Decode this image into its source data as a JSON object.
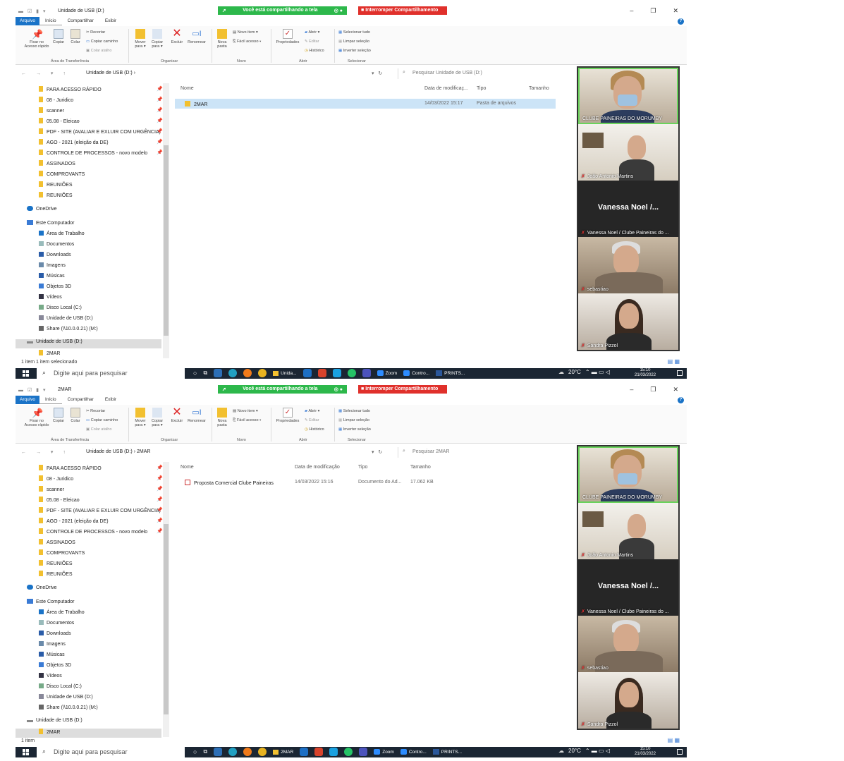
{
  "common": {
    "share_banner": "Você está compartilhando a tela",
    "stop_share": "Interromper Compartilhamento",
    "tabs": [
      "Arquivo",
      "Início",
      "Compartilhar",
      "Exibir"
    ],
    "ribbon": {
      "pin": "Fixar no\nAcesso rápido",
      "copy": "Copiar",
      "paste": "Colar",
      "cut": "Recortar",
      "copy_path": "Copiar caminho",
      "paste_shortcut": "Colar atalho",
      "move_to": "Mover\npara ▾",
      "copy_to": "Copiar\npara ▾",
      "delete": "Excluir",
      "rename": "Renomear",
      "new_folder": "Nova\npasta",
      "new_item": "Novo item ▾",
      "easy_access": "Fácil acesso ▾",
      "properties": "Propriedades",
      "open": "Abrir ▾",
      "edit": "Editar",
      "history": "Histórico",
      "select_all": "Selecionar tudo",
      "select_none": "Limpar seleção",
      "invert": "Inverter seleção",
      "groups": [
        "Área de Transferência",
        "Organizar",
        "Novo",
        "Abrir",
        "Selecionar"
      ]
    },
    "nav_items": [
      {
        "label": "PARA ACESSO RÁPIDO",
        "pin": true
      },
      {
        "label": "08 - Juridico",
        "pin": true
      },
      {
        "label": "scanner",
        "pin": true
      },
      {
        "label": "05.08 - Eleicao",
        "pin": true
      },
      {
        "label": "PDF - SITE (AVALIAR E EXLUIR COM URGÊNCIA)",
        "pin": true
      },
      {
        "label": "AGO - 2021 (eleição da DE)",
        "pin": true
      },
      {
        "label": "CONTROLE DE PROCESSOS - novo modelo",
        "pin": true
      },
      {
        "label": "ASSINADOS",
        "pin": false
      },
      {
        "label": "COMPROVANTS",
        "pin": false
      },
      {
        "label": "REUNIÕES",
        "pin": false
      },
      {
        "label": "REUNIÕES",
        "pin": false
      }
    ],
    "onedrive": "OneDrive",
    "this_pc": "Este Computador",
    "pc_items": [
      "Área de Trabalho",
      "Documentos",
      "Downloads",
      "Imagens",
      "Músicas",
      "Objetos 3D",
      "Vídeos",
      "Disco Local (C:)",
      "Unidade de USB (D:)",
      "Share (\\\\10.0.0.21) (M:)"
    ],
    "usb_drive": "Unidade de USB (D:)",
    "sub_folder": "2MAR",
    "participants": [
      {
        "name": "CLUBE PAINEIRAS DO MORUMBY"
      },
      {
        "name": "João Antonio Martins"
      },
      {
        "name": "Vanessa Noel / Clube Paineiras do ...",
        "big": "Vanessa Noel /..."
      },
      {
        "name": "sebastiao"
      },
      {
        "name": "Sandra Pizzol"
      }
    ],
    "taskbar": {
      "search": "Digite aqui para pesquisar",
      "apps": [
        "Unida...",
        "Zoom",
        "Contro...",
        "PRINTS..."
      ],
      "app2_first": "2MAR",
      "weather": "20°C",
      "time": "15:10",
      "date": "21/03/2022"
    }
  },
  "shot1": {
    "title": "Unidade de USB (D:)",
    "path": "Unidade de USB (D:) ›",
    "search": "Pesquisar Unidade de USB (D:)",
    "headers": [
      "Nome",
      "Data de modificaç...",
      "Tipo",
      "Tamanho"
    ],
    "rows": [
      {
        "name": "2MAR",
        "date": "14/03/2022 15:17",
        "type": "Pasta de arquivos",
        "size": ""
      }
    ],
    "status": "1 item     1 item selecionado"
  },
  "shot2": {
    "title": "2MAR",
    "path": "Unidade de USB (D:)  ›  2MAR",
    "search": "Pesquisar 2MAR",
    "headers": [
      "Nome",
      "Data de modificação",
      "Tipo",
      "Tamanho"
    ],
    "rows": [
      {
        "name": "Proposta Comercial Clube Paineiras",
        "date": "14/03/2022 15:16",
        "type": "Documento do Ad...",
        "size": "17.062 KB"
      }
    ],
    "status": "1 item"
  },
  "colors": {
    "accent": "#1a73c7",
    "share_green": "#2db84b",
    "stop_red": "#e0302b",
    "taskbar": "#1b2633",
    "selection": "#cce4f7"
  }
}
